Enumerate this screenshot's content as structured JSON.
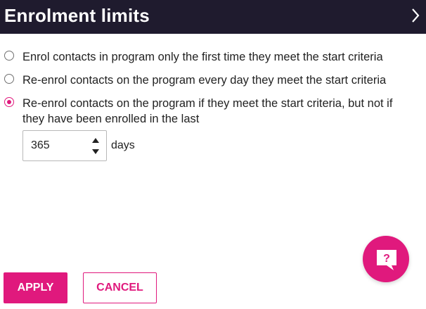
{
  "header": {
    "title": "Enrolment limits",
    "expand_icon": "chevron-right-icon"
  },
  "options": [
    {
      "label": "Enrol contacts in program only the first time they meet the start criteria",
      "selected": false
    },
    {
      "label": "Re-enrol contacts on the program every day they meet the start criteria",
      "selected": false
    },
    {
      "label": "Re-enrol contacts on the program if they meet the start criteria, but not if they have been enrolled in the last",
      "selected": true
    }
  ],
  "interval": {
    "value": "365",
    "unit": "days"
  },
  "actions": {
    "apply_label": "APPLY",
    "cancel_label": "CANCEL"
  },
  "help": {
    "icon": "help-chat-icon",
    "glyph": "?"
  },
  "colors": {
    "header_bg": "#1f1b2e",
    "accent": "#e0197d"
  }
}
